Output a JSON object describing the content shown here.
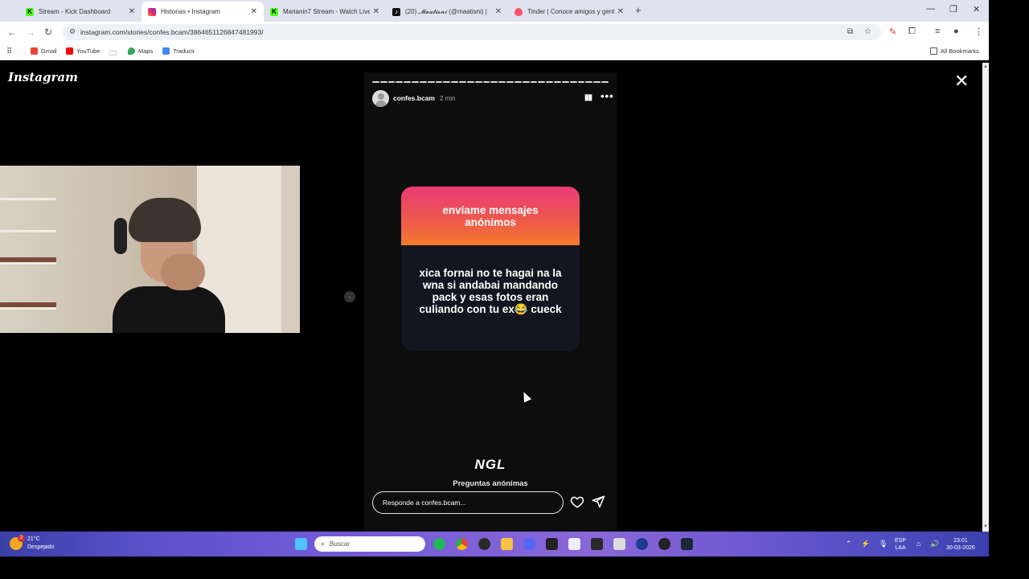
{
  "browser": {
    "tabs": [
      {
        "title": "Stream - Kick Dashboard",
        "active": false,
        "favicon_color": "#53fc18",
        "favicon_letter": "K"
      },
      {
        "title": "Historias • Instagram",
        "active": true,
        "favicon_color": "#e1306c",
        "favicon_letter": ""
      },
      {
        "title": "Marianin7 Stream - Watch Live",
        "active": false,
        "favicon_color": "#53fc18",
        "favicon_letter": "K"
      },
      {
        "title": "(20) 𝓜𝓪𝓪𝓽𝓲𝓼𝓷𝓲 (@maatisni) |",
        "active": false,
        "favicon_color": "#111111",
        "favicon_letter": ""
      },
      {
        "title": "Tinder | Conoce amigos y gente",
        "active": false,
        "favicon_color": "#fd5068",
        "favicon_letter": ""
      }
    ],
    "new_tab": "+",
    "window_controls": [
      "—",
      "❐",
      "✕"
    ],
    "url": "instagram.com/stories/confes.bcam/3864651126847481993/",
    "bookmarks": [
      {
        "label": "",
        "icon": "apps-grid-icon"
      },
      {
        "label": "Gmail",
        "color": "#ea4335"
      },
      {
        "label": "YouTube",
        "color": "#ff0000"
      },
      {
        "label": "",
        "icon": "folder-icon"
      },
      {
        "label": "Maps",
        "color": "#34a853"
      },
      {
        "label": "Traducir",
        "color": "#4285f4"
      }
    ],
    "all_bookmarks": "All Bookmarks"
  },
  "instagram": {
    "logo": "Instagram",
    "close": "✕",
    "story": {
      "username": "confes.bcam",
      "time": "2 min",
      "progress_segments": 30,
      "card_title": "envíame mensajes anónimos",
      "card_message": "xica fornai no te hagai na la wna si andabai mandando pack y esas fotos eran culiando con tu ex😂 cueck",
      "ngl_logo": "NGL",
      "ngl_subtitle": "Preguntas anónimas",
      "reply_placeholder": "Responde a confes.bcam..."
    }
  },
  "taskbar": {
    "weather_temp": "21°C",
    "weather_desc": "Despejado",
    "weather_badge": "2",
    "search_label": "Buscar",
    "lang_top": "ESP",
    "lang_bottom": "LAA",
    "clock_time": "23:01",
    "clock_date": "30-03-2026"
  }
}
